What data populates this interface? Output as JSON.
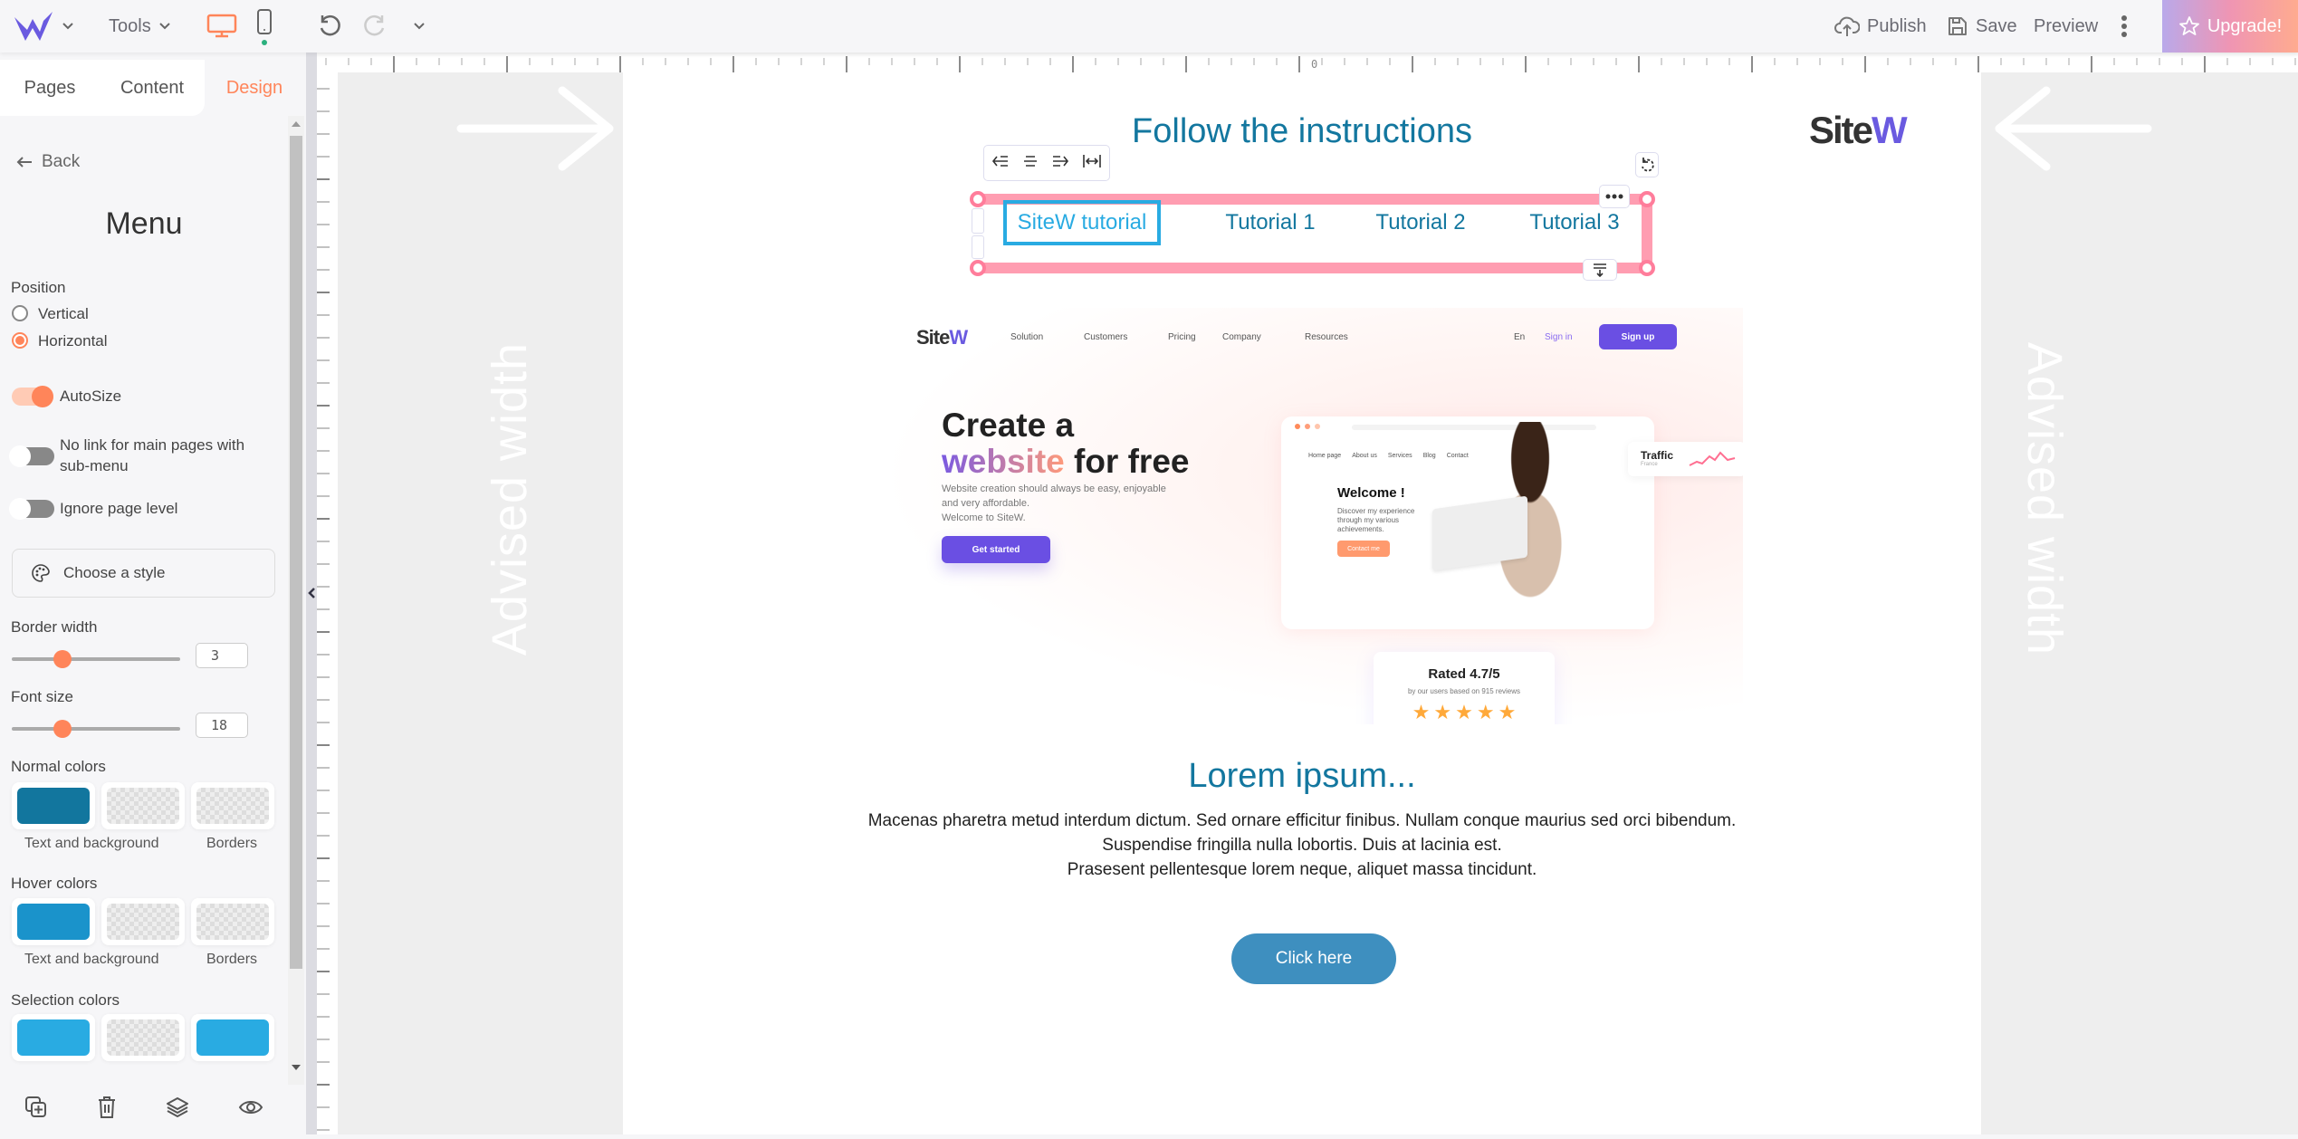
{
  "topbar": {
    "tools_label": "Tools",
    "publish_label": "Publish",
    "save_label": "Save",
    "preview_label": "Preview",
    "upgrade_label": "Upgrade!",
    "active_device": "desktop"
  },
  "left_panel": {
    "tabs": [
      {
        "label": "Pages",
        "active": false
      },
      {
        "label": "Content",
        "active": false
      },
      {
        "label": "Design",
        "active": true
      }
    ],
    "back_label": "Back",
    "title": "Menu",
    "position": {
      "label": "Position",
      "options": [
        {
          "label": "Vertical",
          "selected": false
        },
        {
          "label": "Horizontal",
          "selected": true
        }
      ]
    },
    "toggles": [
      {
        "label": "AutoSize",
        "on": true
      },
      {
        "label": "No link for main pages with sub-menu",
        "on": false
      },
      {
        "label": "Ignore page level",
        "on": false
      }
    ],
    "choose_style_label": "Choose a style",
    "border_width": {
      "label": "Border width",
      "value": "3"
    },
    "font_size": {
      "label": "Font size",
      "value": "18"
    },
    "color_groups": [
      {
        "label": "Normal colors",
        "text_bg_color": "#12769e",
        "bg_transparent": true,
        "border_transparent": true,
        "text_bg_label": "Text and background",
        "borders_label": "Borders"
      },
      {
        "label": "Hover colors",
        "text_bg_color": "#1a93cb",
        "bg_transparent": true,
        "border_transparent": true,
        "text_bg_label": "Text and background",
        "borders_label": "Borders"
      },
      {
        "label": "Selection colors",
        "text_bg_color": "#29abe2",
        "bg_transparent": true,
        "border_color": "#29abe2"
      }
    ]
  },
  "canvas": {
    "ruler_zero": "0",
    "advised_width_label": "Advised width",
    "page": {
      "title": "Follow the instructions",
      "logo": {
        "main": "Site",
        "accent": "W"
      },
      "menu_items": [
        {
          "label": "SiteW tutorial",
          "selected": true
        },
        {
          "label": "Tutorial 1",
          "selected": false
        },
        {
          "label": "Tutorial 2",
          "selected": false
        },
        {
          "label": "Tutorial 3",
          "selected": false
        }
      ],
      "hero": {
        "nav": [
          "Solution",
          "Customers",
          "Pricing",
          "Company",
          "Resources"
        ],
        "lang": "En",
        "signin": "Sign in",
        "signup": "Sign up",
        "headline_1": "Create a",
        "headline_2_accent": "website",
        "headline_2_rest": " for free",
        "subtitle_lines": [
          "Website creation should always be easy, enjoyable",
          "and very affordable.",
          "Welcome to SiteW."
        ],
        "cta": "Get started",
        "mock_nav": [
          "Home page",
          "About us",
          "Services",
          "Blog",
          "Contact"
        ],
        "mock_welcome": "Welcome !",
        "mock_text": [
          "Discover my experience",
          "through my various",
          "achievements."
        ],
        "mock_cta": "Contact me",
        "traffic_label": "Traffic",
        "traffic_sub": "France",
        "rating_title": "Rated 4.7/5",
        "rating_sub": "by our users based on 915 reviews",
        "stars": 5
      },
      "lorem_title": "Lorem ipsum...",
      "lorem_lines": [
        "Macenas pharetra metud interdum dictum. Sed ornare efficitur finibus. Nullam conque maurius sed orci bibendum.",
        "Suspendise fringilla nulla lobortis. Duis at lacinia est.",
        "Prasesent pellentesque lorem neque, aliquet massa tincidunt."
      ],
      "button_label": "Click here"
    }
  }
}
